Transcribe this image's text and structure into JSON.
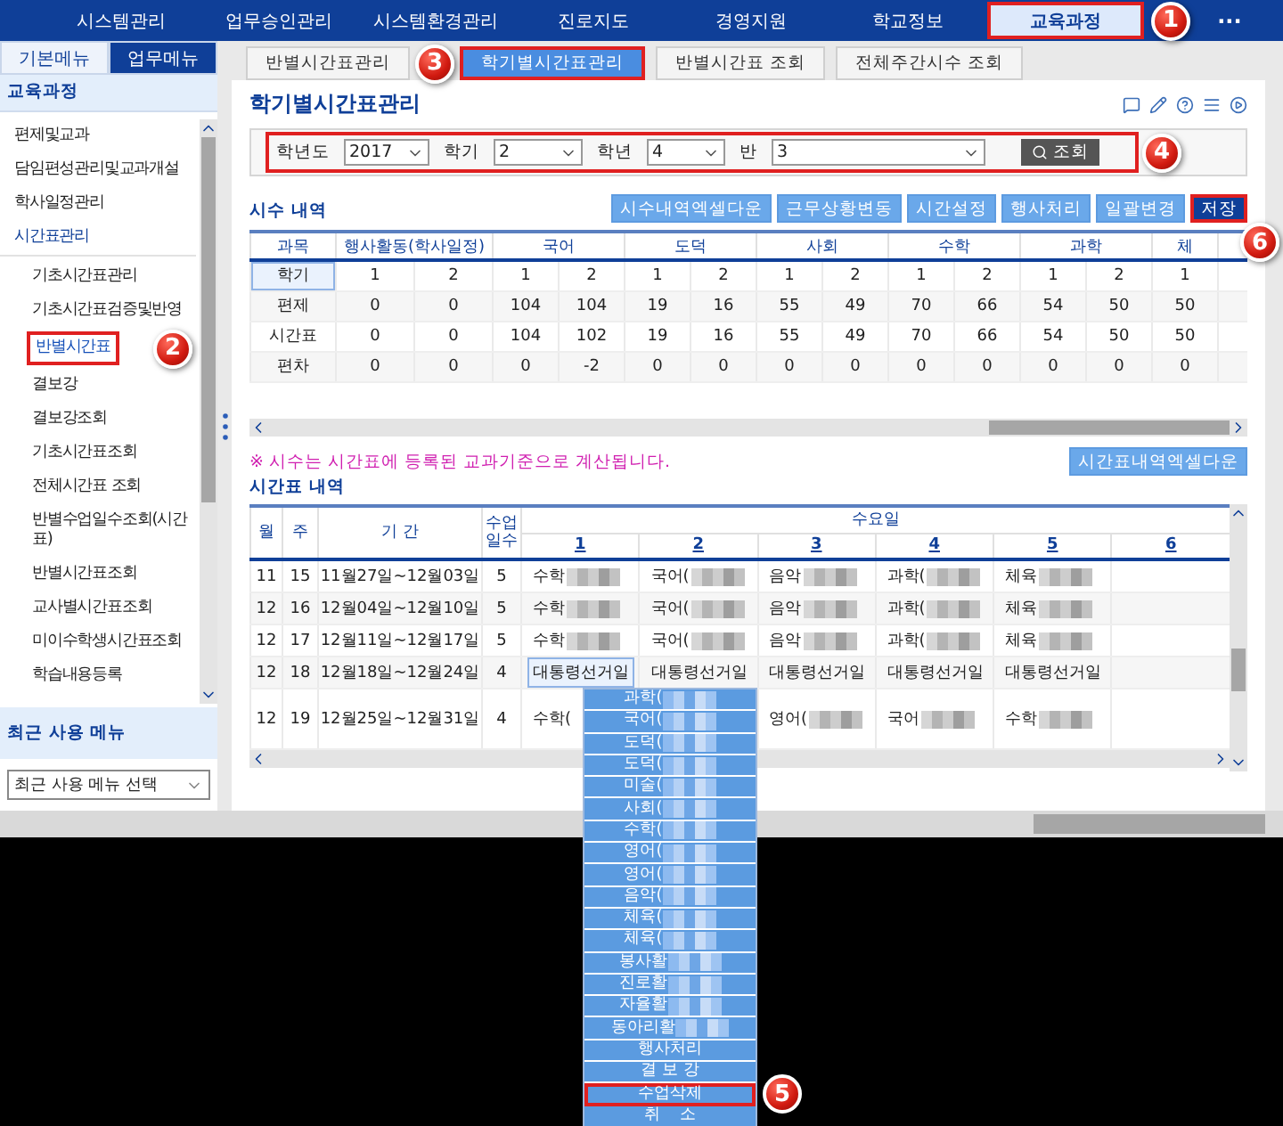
{
  "nav": {
    "items": [
      {
        "label": "시스템관리",
        "selected": false
      },
      {
        "label": "업무승인관리",
        "selected": false
      },
      {
        "label": "시스템환경관리",
        "selected": false
      },
      {
        "label": "진로지도",
        "selected": false
      },
      {
        "label": "경영지원",
        "selected": false
      },
      {
        "label": "학교정보",
        "selected": false
      },
      {
        "label": "교육과정",
        "selected": true,
        "callout": "1"
      }
    ],
    "more": "···"
  },
  "sidebar": {
    "tabs": [
      {
        "label": "기본메뉴",
        "selected": false
      },
      {
        "label": "업무메뉴",
        "selected": true
      }
    ],
    "section": "교육과정",
    "items": [
      {
        "label": "편제및교과"
      },
      {
        "label": "담임편성관리및교과개설"
      },
      {
        "label": "학사일정관리"
      },
      {
        "label": "시간표관리",
        "children": [
          {
            "label": "기초시간표관리",
            "selected": false
          },
          {
            "label": "기초시간표검증및반영",
            "selected": false
          },
          {
            "label": "반별시간표",
            "selected": true,
            "callout": "2"
          },
          {
            "label": "결보강",
            "selected": false
          },
          {
            "label": "결보강조회",
            "selected": false
          },
          {
            "label": "기초시간표조회",
            "selected": false
          },
          {
            "label": "전체시간표 조회",
            "selected": false
          },
          {
            "label": "반별수업일수조회(시간표)",
            "selected": false
          },
          {
            "label": "반별시간표조회",
            "selected": false
          },
          {
            "label": "교사별시간표조회",
            "selected": false
          },
          {
            "label": "미이수학생시간표조회",
            "selected": false
          },
          {
            "label": "학습내용등록",
            "selected": false
          }
        ]
      }
    ],
    "recent": {
      "title": "최근 사용 메뉴",
      "select": "최근 사용 메뉴 선택"
    }
  },
  "page_tabs": [
    {
      "label": "반별시간표관리",
      "selected": false
    },
    {
      "label": "학기별시간표관리",
      "selected": true,
      "callout": "3"
    },
    {
      "label": "반별시간표 조회",
      "selected": false
    },
    {
      "label": "전체주간시수 조회",
      "selected": false
    }
  ],
  "title": "학기별시간표관리",
  "filters": {
    "callout": "4",
    "fields": [
      {
        "label": "학년도",
        "value": "2017"
      },
      {
        "label": "학기",
        "value": "2"
      },
      {
        "label": "학년",
        "value": "4"
      },
      {
        "label": "반",
        "value": "3"
      }
    ],
    "search_button": "조회"
  },
  "hours": {
    "title": "시수 내역",
    "buttons": [
      {
        "label": "시수내역엑셀다운",
        "primary": false
      },
      {
        "label": "근무상황변동",
        "primary": false
      },
      {
        "label": "시간설정",
        "primary": false
      },
      {
        "label": "행사처리",
        "primary": false
      },
      {
        "label": "일괄변경",
        "primary": false
      },
      {
        "label": "저장",
        "primary": true,
        "callout": "6"
      }
    ],
    "first_column": "과목",
    "groups": [
      "행사활동(학사일정)",
      "국어",
      "도덕",
      "사회",
      "수학",
      "과학",
      "체"
    ],
    "rows": [
      {
        "label": "학기",
        "selected": true,
        "values": [
          "1",
          "2",
          "1",
          "2",
          "1",
          "2",
          "1",
          "2",
          "1",
          "2",
          "1",
          "2",
          "1"
        ]
      },
      {
        "label": "편제",
        "selected": false,
        "values": [
          "0",
          "0",
          "104",
          "104",
          "19",
          "16",
          "55",
          "49",
          "70",
          "66",
          "54",
          "50",
          "50"
        ]
      },
      {
        "label": "시간표",
        "selected": false,
        "values": [
          "0",
          "0",
          "104",
          "102",
          "19",
          "16",
          "55",
          "49",
          "70",
          "66",
          "54",
          "50",
          "50"
        ]
      },
      {
        "label": "편차",
        "selected": false,
        "values": [
          "0",
          "0",
          "0",
          "-2",
          "0",
          "0",
          "0",
          "0",
          "0",
          "0",
          "0",
          "0",
          "0"
        ]
      }
    ]
  },
  "note": "※ 시수는 시간표에 등록된 교과기준으로 계산됩니다.",
  "timetable": {
    "title": "시간표 내역",
    "excel_button": "시간표내역엑셀다운",
    "columns": [
      "월",
      "주",
      "기 간",
      "수업일수"
    ],
    "day": "수요일",
    "periods": [
      "1",
      "2",
      "3",
      "4",
      "5",
      "6"
    ],
    "rows": [
      {
        "month": "11",
        "week": "15",
        "range": "11월27일~12월03일",
        "days": "5",
        "cells": [
          {
            "text": "수학",
            "blurred": true,
            "selected": false
          },
          {
            "text": "국어(",
            "blurred": true,
            "selected": false
          },
          {
            "text": "음악",
            "blurred": true,
            "selected": false
          },
          {
            "text": "과학(",
            "blurred": true,
            "selected": false
          },
          {
            "text": "체육",
            "blurred": true,
            "selected": false
          },
          null
        ]
      },
      {
        "month": "12",
        "week": "16",
        "range": "12월04일~12월10일",
        "days": "5",
        "cells": [
          {
            "text": "수학",
            "blurred": true,
            "selected": false
          },
          {
            "text": "국어(",
            "blurred": true,
            "selected": false
          },
          {
            "text": "음악",
            "blurred": true,
            "selected": false
          },
          {
            "text": "과학(",
            "blurred": true,
            "selected": false
          },
          {
            "text": "체육",
            "blurred": true,
            "selected": false
          },
          null
        ]
      },
      {
        "month": "12",
        "week": "17",
        "range": "12월11일~12월17일",
        "days": "5",
        "cells": [
          {
            "text": "수학",
            "blurred": true,
            "selected": false
          },
          {
            "text": "국어(",
            "blurred": true,
            "selected": false
          },
          {
            "text": "음악",
            "blurred": true,
            "selected": false
          },
          {
            "text": "과학(",
            "blurred": true,
            "selected": false
          },
          {
            "text": "체육",
            "blurred": true,
            "selected": false
          },
          null
        ]
      },
      {
        "month": "12",
        "week": "18",
        "range": "12월18일~12월24일",
        "days": "4",
        "cells": [
          {
            "text": "대통령선거일",
            "blurred": false,
            "selected": true
          },
          {
            "text": "대통령선거일",
            "blurred": false,
            "selected": false
          },
          {
            "text": "대통령선거일",
            "blurred": false,
            "selected": false
          },
          {
            "text": "대통령선거일",
            "blurred": false,
            "selected": false
          },
          {
            "text": "대통령선거일",
            "blurred": false,
            "selected": false
          },
          null
        ]
      },
      {
        "month": "12",
        "week": "19",
        "range": "12월25일~12월31일",
        "days": "4",
        "cells": [
          {
            "text": "수학(",
            "blurred": false,
            "selected": false
          },
          null,
          {
            "text": "영어(",
            "blurred": true,
            "selected": false
          },
          {
            "text": "국어",
            "blurred": true,
            "selected": false
          },
          {
            "text": "수학",
            "blurred": true,
            "selected": false
          },
          null
        ]
      }
    ]
  },
  "context_menu": [
    {
      "label": "과학(",
      "blurred": true
    },
    {
      "label": "국어(",
      "blurred": true
    },
    {
      "label": "도덕(",
      "blurred": true
    },
    {
      "label": "도덕(",
      "blurred": true
    },
    {
      "label": "미술(",
      "blurred": true
    },
    {
      "label": "사회(",
      "blurred": true
    },
    {
      "label": "수학(",
      "blurred": true
    },
    {
      "label": "영어(",
      "blurred": true
    },
    {
      "label": "영어(",
      "blurred": true
    },
    {
      "label": "음악(",
      "blurred": true
    },
    {
      "label": "체육(",
      "blurred": true
    },
    {
      "label": "체육(",
      "blurred": true
    },
    {
      "label": "봉사활",
      "blurred": true
    },
    {
      "label": "진로활",
      "blurred": true
    },
    {
      "label": "자율활",
      "blurred": true
    },
    {
      "label": "동아리활",
      "blurred": true
    },
    {
      "label": "행사처리",
      "blurred": false
    },
    {
      "label": "결 보 강",
      "blurred": false
    },
    {
      "label": "수업삭제",
      "blurred": false,
      "callout": "5"
    },
    {
      "label": "취    소",
      "blurred": false
    }
  ]
}
